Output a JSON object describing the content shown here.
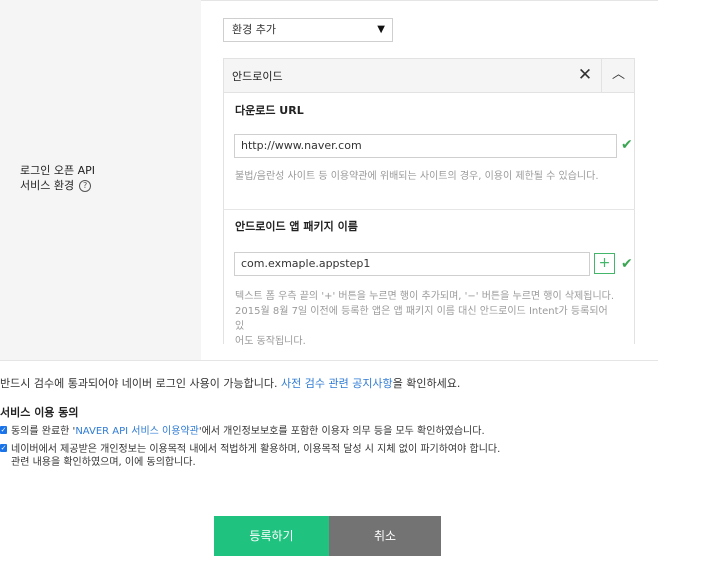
{
  "field": {
    "label_line1": "로그인 오픈 API",
    "label_line2": "서비스 환경",
    "help_icon": "question-circle-icon"
  },
  "env_select": {
    "value": "환경 추가",
    "icon": "caret-down-icon"
  },
  "panel": {
    "title": "안드로이드",
    "close_icon": "close-icon",
    "collapse_icon": "chevron-up-icon",
    "download_url": {
      "title": "다운로드 URL",
      "value": "http://www.naver.com",
      "hint": "불법/음란성 사이트 등 이용약관에 위배되는 사이트의 경우, 이용이 제한될 수 있습니다."
    },
    "package": {
      "title": "안드로이드 앱 패키지 이름",
      "value": "com.exmaple.appstep1",
      "add_label": "+",
      "hint_line1": "텍스트 폼 우측 끝의 '+' 버튼을 누르면 행이 추가되며, '−' 버튼을 누르면 행이 삭제됩니다.",
      "hint_line2": "2015월 8월 7일 이전에 등록한 앱은 앱 패키지 이름 대신 안드로이드 Intent가 등록되어 있",
      "hint_line3": "어도 동작됩니다."
    }
  },
  "notice": {
    "prefix": "반드시 검수에 통과되어야 네이버 로그인 사용이 가능합니다. ",
    "link": "사전 검수 관련 공지사항",
    "suffix": "을 확인하세요."
  },
  "agreement": {
    "title": "서비스 이용 동의",
    "item1_prefix": "동의를 완료한 '",
    "item1_link": "NAVER API 서비스 이용약관",
    "item1_suffix": "'에서 개인정보보호를 포함한 이용자 의무 등을 모두 확인하였습니다.",
    "item2_line1": "네이버에서 제공받은 개인정보는 이용목적 내에서 적법하게 활용하며, 이용목적 달성 시 지체 없이 파기하여야 합니다.",
    "item2_line2": "관련 내용을 확인하였으며, 이에 동의합니다."
  },
  "buttons": {
    "register": "등록하기",
    "cancel": "취소"
  },
  "colors": {
    "accent_green": "#1fc27f",
    "link_blue": "#2f7bd5",
    "cancel_gray": "#737373"
  }
}
